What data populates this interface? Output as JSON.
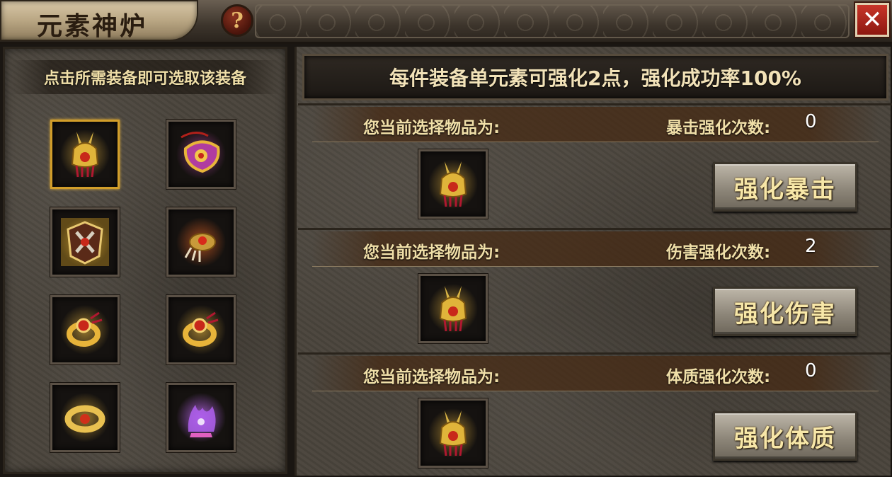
{
  "window": {
    "title": "元素神炉",
    "help_glyph": "?",
    "close_glyph": "✕"
  },
  "left_panel": {
    "instruction": "点击所需装备即可选取该装备",
    "slots": [
      {
        "icon": "golden-helmet-icon",
        "selected": true
      },
      {
        "icon": "pink-pendant-icon",
        "selected": false
      },
      {
        "icon": "ornate-armor-icon",
        "selected": false
      },
      {
        "icon": "claw-bracelet-icon",
        "selected": false
      },
      {
        "icon": "gold-ring-icon",
        "selected": false
      },
      {
        "icon": "gold-ring-icon",
        "selected": false
      },
      {
        "icon": "ruby-ring-icon",
        "selected": false
      },
      {
        "icon": "purple-flame-boots-icon",
        "selected": false
      }
    ]
  },
  "right_panel": {
    "notice": "每件装备单元素可强化2点，强化成功率100%",
    "sections": [
      {
        "selected_label": "您当前选择物品为:",
        "count_label": "暴击强化次数:",
        "count_value": "0",
        "item_icon": "golden-helmet-icon",
        "button_label": "强化暴击"
      },
      {
        "selected_label": "您当前选择物品为:",
        "count_label": "伤害强化次数:",
        "count_value": "2",
        "item_icon": "golden-helmet-icon",
        "button_label": "强化伤害"
      },
      {
        "selected_label": "您当前选择物品为:",
        "count_label": "体质强化次数:",
        "count_value": "0",
        "item_icon": "golden-helmet-icon",
        "button_label": "强化体质"
      }
    ]
  },
  "colors": {
    "label_gold": "#f0dfa8",
    "button_text": "#f7e7a8",
    "selected_border": "#d29e2a",
    "close_red": "#c8362a"
  }
}
